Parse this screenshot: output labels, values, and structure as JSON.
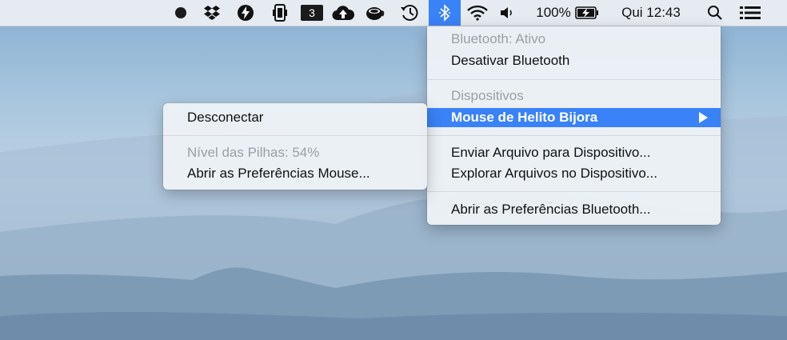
{
  "menubar": {
    "calendar_badge": "3",
    "battery_percent": "100%",
    "clock": "Qui 12:43",
    "icons": [
      "record-icon",
      "dropbox-icon",
      "flash-icon",
      "phone-icon",
      "calendar-badge-icon",
      "cloud-upload-icon",
      "coffee-icon",
      "time-machine-icon",
      "bluetooth-icon",
      "wifi-icon",
      "volume-icon",
      "battery-icon",
      "search-icon",
      "list-icon"
    ]
  },
  "bluetooth_menu": {
    "status": "Bluetooth:  Ativo",
    "toggle": "Desativar Bluetooth",
    "devices_header": "Dispositivos",
    "device": "Mouse de Helito Bijora",
    "send_file": "Enviar Arquivo para Dispositivo...",
    "browse_files": "Explorar Arquivos no Dispositivo...",
    "open_prefs": "Abrir as Preferências Bluetooth..."
  },
  "device_submenu": {
    "disconnect": "Desconectar",
    "battery_level": "Nível das Pilhas: 54%",
    "open_mouse_prefs": "Abrir as Preferências Mouse..."
  },
  "colors": {
    "accent": "#3a82f7"
  }
}
